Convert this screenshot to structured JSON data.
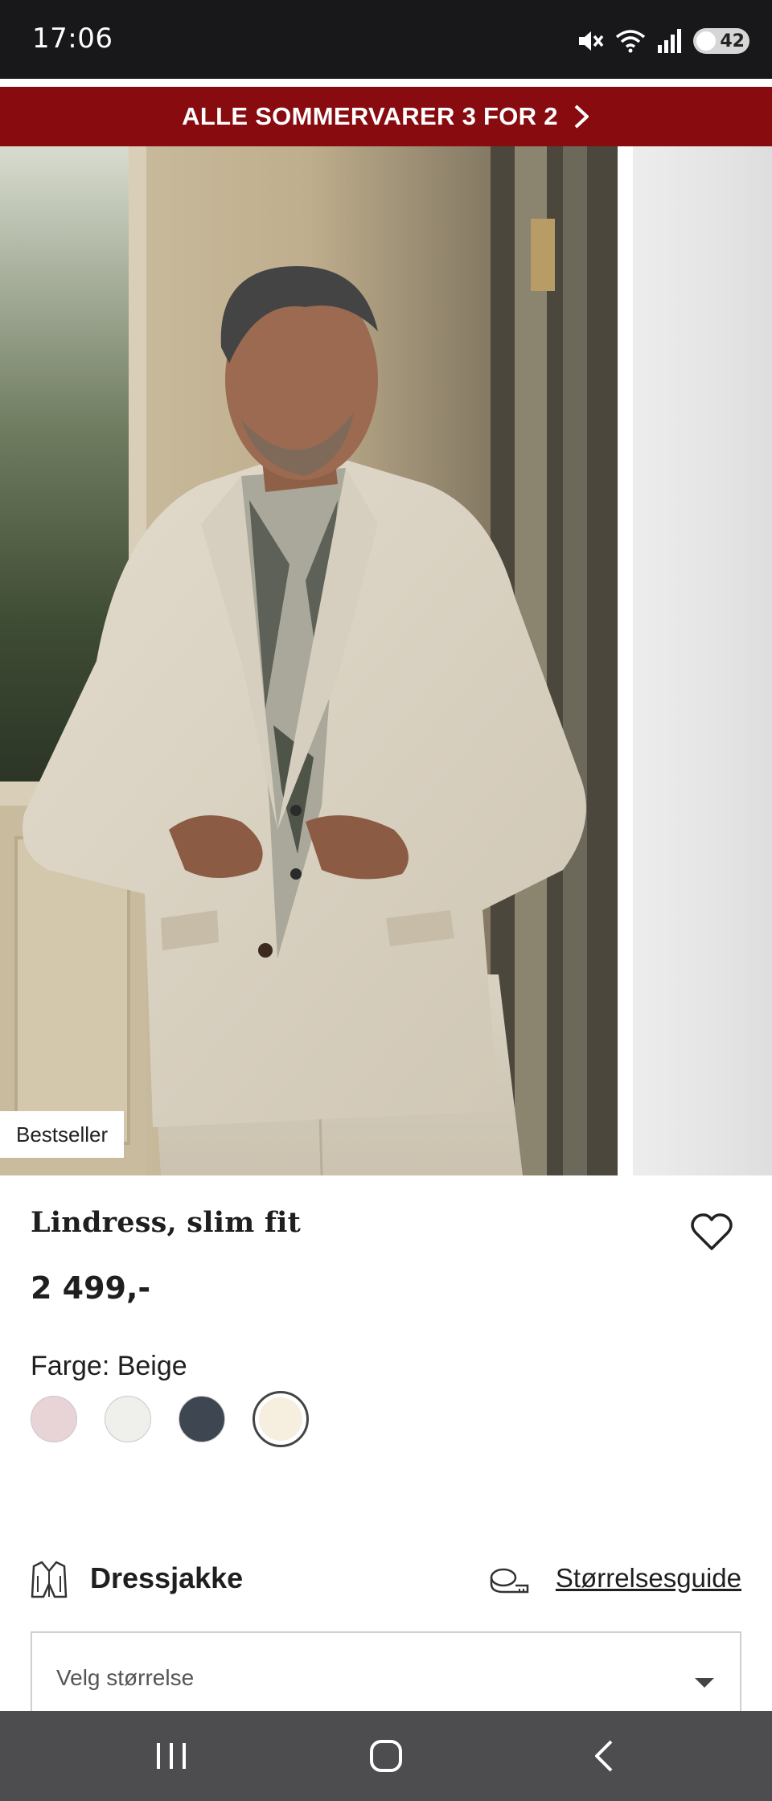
{
  "status_bar": {
    "time": "17:06",
    "battery_level": "42",
    "icons": [
      "mute-icon",
      "wifi-icon",
      "signal-icon",
      "battery-icon"
    ]
  },
  "promo_banner": {
    "text": "ALLE SOMMERVARER 3 FOR 2",
    "background_color": "#870b0f",
    "icon": "chevron-right-icon"
  },
  "gallery": {
    "badge": "Bestseller"
  },
  "product": {
    "title": "Lindress, slim fit",
    "price": "2 499,-",
    "color_label": "Farge: Beige",
    "swatches": [
      {
        "color": "#e8d3d6",
        "selected": false
      },
      {
        "color": "#efefeb",
        "selected": false
      },
      {
        "color": "#3e4652",
        "selected": false
      },
      {
        "color": "#f6efe0",
        "selected": true
      }
    ]
  },
  "size_section": {
    "category": "Dressjakke",
    "guide_link": "Størrelsesguide",
    "select_placeholder": "Velg størrelse"
  },
  "nav_bar": {
    "buttons": [
      "recent-apps-icon",
      "home-icon",
      "back-icon"
    ]
  }
}
